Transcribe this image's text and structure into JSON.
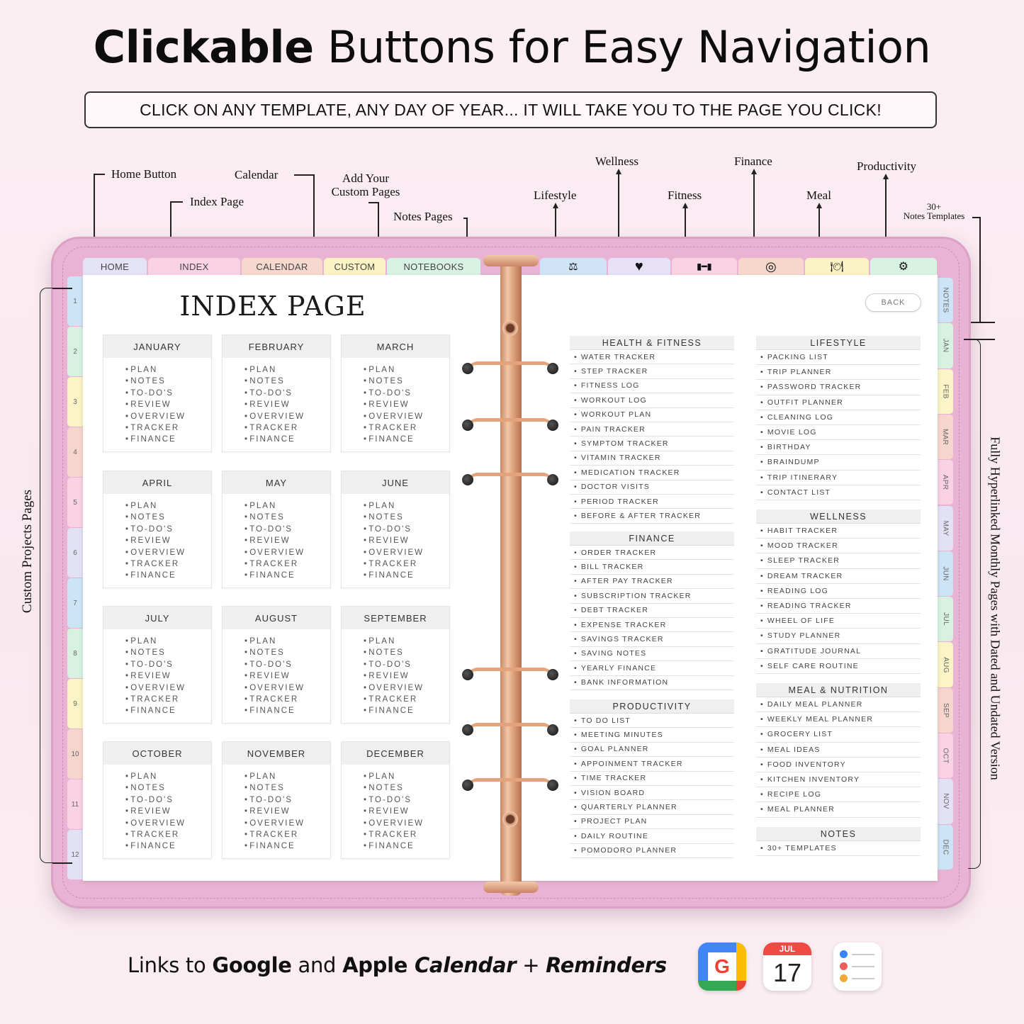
{
  "header": {
    "title_bold": "Clickable",
    "title_rest": " Buttons for Easy Navigation",
    "subtitle": "CLICK ON ANY TEMPLATE, ANY DAY OF YEAR... IT WILL TAKE YOU TO THE PAGE YOU CLICK!"
  },
  "callouts": {
    "home": "Home Button",
    "index": "Index Page",
    "calendar": "Calendar",
    "custom_line1": "Add Your",
    "custom_line2": "Custom Pages",
    "notes": "Notes Pages",
    "lifestyle": "Lifestyle",
    "wellness": "Wellness",
    "fitness": "Fitness",
    "finance": "Finance",
    "meal": "Meal",
    "productivity": "Productivity",
    "notes_templates_line1": "30+",
    "notes_templates_line2": "Notes Templates",
    "custom_projects": "Custom Projects Pages",
    "monthly_pages": "Fully Hyperlinked Monthly Pages with Dated and Undated Version"
  },
  "top_tabs": [
    {
      "label": "HOME",
      "color": "#e4e2f5"
    },
    {
      "label": "INDEX",
      "color": "#f9d3e4"
    },
    {
      "label": "CALENDAR",
      "color": "#f6d8cf"
    },
    {
      "label": "CUSTOM",
      "color": "#fbf3c4"
    },
    {
      "label": "NOTEBOOKS",
      "color": "#d8f3e3"
    }
  ],
  "icon_tabs": [
    {
      "icon": "lifestyle-icon",
      "glyph": "⚖",
      "color": "#cfe4f6"
    },
    {
      "icon": "heart-icon",
      "glyph": "♥",
      "color": "#e6e1f6"
    },
    {
      "icon": "dumbbell-icon",
      "glyph": "▮━▮",
      "color": "#fad2e3"
    },
    {
      "icon": "finance-coin-icon",
      "glyph": "◎",
      "color": "#f6d7cc"
    },
    {
      "icon": "meal-plate-icon",
      "glyph": "🍽",
      "color": "#fbf3c3"
    },
    {
      "icon": "productivity-icon",
      "glyph": "⚙",
      "color": "#d9f3e2"
    }
  ],
  "left_tabs": [
    {
      "label": "1",
      "color": "#cde3f6"
    },
    {
      "label": "2",
      "color": "#d8f2e2"
    },
    {
      "label": "3",
      "color": "#fbf4c6"
    },
    {
      "label": "4",
      "color": "#f6d6cc"
    },
    {
      "label": "5",
      "color": "#f9d2e3"
    },
    {
      "label": "6",
      "color": "#e3e1f6"
    },
    {
      "label": "7",
      "color": "#cde3f6"
    },
    {
      "label": "8",
      "color": "#d8f2e2"
    },
    {
      "label": "9",
      "color": "#fbf4c6"
    },
    {
      "label": "10",
      "color": "#f6d6cc"
    },
    {
      "label": "11",
      "color": "#f9d2e3"
    },
    {
      "label": "12",
      "color": "#e3e1f6"
    }
  ],
  "right_tabs": [
    {
      "label": "NOTES",
      "color": "#cde3f6"
    },
    {
      "label": "JAN",
      "color": "#d8f2e2"
    },
    {
      "label": "FEB",
      "color": "#fbf4c6"
    },
    {
      "label": "MAR",
      "color": "#f6d6cc"
    },
    {
      "label": "APR",
      "color": "#f9d2e3"
    },
    {
      "label": "MAY",
      "color": "#e3e1f6"
    },
    {
      "label": "JUN",
      "color": "#cde3f6"
    },
    {
      "label": "JUL",
      "color": "#d8f2e2"
    },
    {
      "label": "AUG",
      "color": "#fbf4c6"
    },
    {
      "label": "SEP",
      "color": "#f6d6cc"
    },
    {
      "label": "OCT",
      "color": "#f9d2e3"
    },
    {
      "label": "NOV",
      "color": "#e3e1f6"
    },
    {
      "label": "DEC",
      "color": "#cde3f6"
    }
  ],
  "index_page": {
    "title": "INDEX PAGE",
    "month_items": [
      "PLAN",
      "NOTES",
      "TO-DO'S",
      "REVIEW",
      "OVERVIEW",
      "TRACKER",
      "FINANCE"
    ],
    "months": [
      "JANUARY",
      "FEBRUARY",
      "MARCH",
      "APRIL",
      "MAY",
      "JUNE",
      "JULY",
      "AUGUST",
      "SEPTEMBER",
      "OCTOBER",
      "NOVEMBER",
      "DECEMBER"
    ]
  },
  "right_page": {
    "back_label": "BACK",
    "categories_left": [
      {
        "title": "HEALTH & FITNESS",
        "items": [
          "WATER TRACKER",
          "STEP TRACKER",
          "FITNESS LOG",
          "WORKOUT LOG",
          "WORKOUT PLAN",
          "PAIN TRACKER",
          "SYMPTOM TRACKER",
          "VITAMIN TRACKER",
          "MEDICATION TRACKER",
          "DOCTOR VISITS",
          "PERIOD TRACKER",
          "BEFORE & AFTER TRACKER"
        ]
      },
      {
        "title": "FINANCE",
        "items": [
          "ORDER TRACKER",
          "BILL TRACKER",
          "AFTER PAY TRACKER",
          "SUBSCRIPTION TRACKER",
          "DEBT TRACKER",
          "EXPENSE TRACKER",
          "SAVINGS TRACKER",
          "SAVING NOTES",
          "YEARLY FINANCE",
          "BANK INFORMATION"
        ]
      },
      {
        "title": "PRODUCTIVITY",
        "items": [
          "TO DO LIST",
          "MEETING MINUTES",
          "GOAL PLANNER",
          "APPOINMENT TRACKER",
          "TIME TRACKER",
          "VISION BOARD",
          "QUARTERLY PLANNER",
          "PROJECT PLAN",
          "DAILY ROUTINE",
          "POMODORO PLANNER"
        ]
      }
    ],
    "categories_right": [
      {
        "title": "LIFESTYLE",
        "items": [
          "PACKING LIST",
          "TRIP PLANNER",
          "PASSWORD TRACKER",
          "OUTFIT PLANNER",
          "CLEANING LOG",
          "MOVIE LOG",
          "BIRTHDAY",
          "BRAINDUMP",
          "TRIP ITINERARY",
          "CONTACT LIST"
        ]
      },
      {
        "title": "WELLNESS",
        "items": [
          "HABIT TRACKER",
          "MOOD TRACKER",
          "SLEEP TRACKER",
          "DREAM TRACKER",
          "READING LOG",
          "READING TRACKER",
          "WHEEL OF LIFE",
          "STUDY PLANNER",
          "GRATITUDE JOURNAL",
          "SELF CARE ROUTINE"
        ]
      },
      {
        "title": "MEAL & NUTRITION",
        "items": [
          "DAILY MEAL PLANNER",
          "WEEKLY MEAL PLANNER",
          "GROCERY LIST",
          "MEAL IDEAS",
          "FOOD INVENTORY",
          "KITCHEN INVENTORY",
          "RECIPE LOG",
          "MEAL PLANNER"
        ]
      },
      {
        "title": "NOTES",
        "items": [
          "30+ TEMPLATES"
        ]
      }
    ]
  },
  "footer": {
    "t1": "Links to ",
    "google": "Google",
    "t2": " and ",
    "apple": "Apple",
    "calendar": " Calendar",
    "plus": " + ",
    "reminders": "Reminders",
    "apple_cal_month": "JUL",
    "apple_cal_day": "17",
    "google_letter": "G"
  }
}
